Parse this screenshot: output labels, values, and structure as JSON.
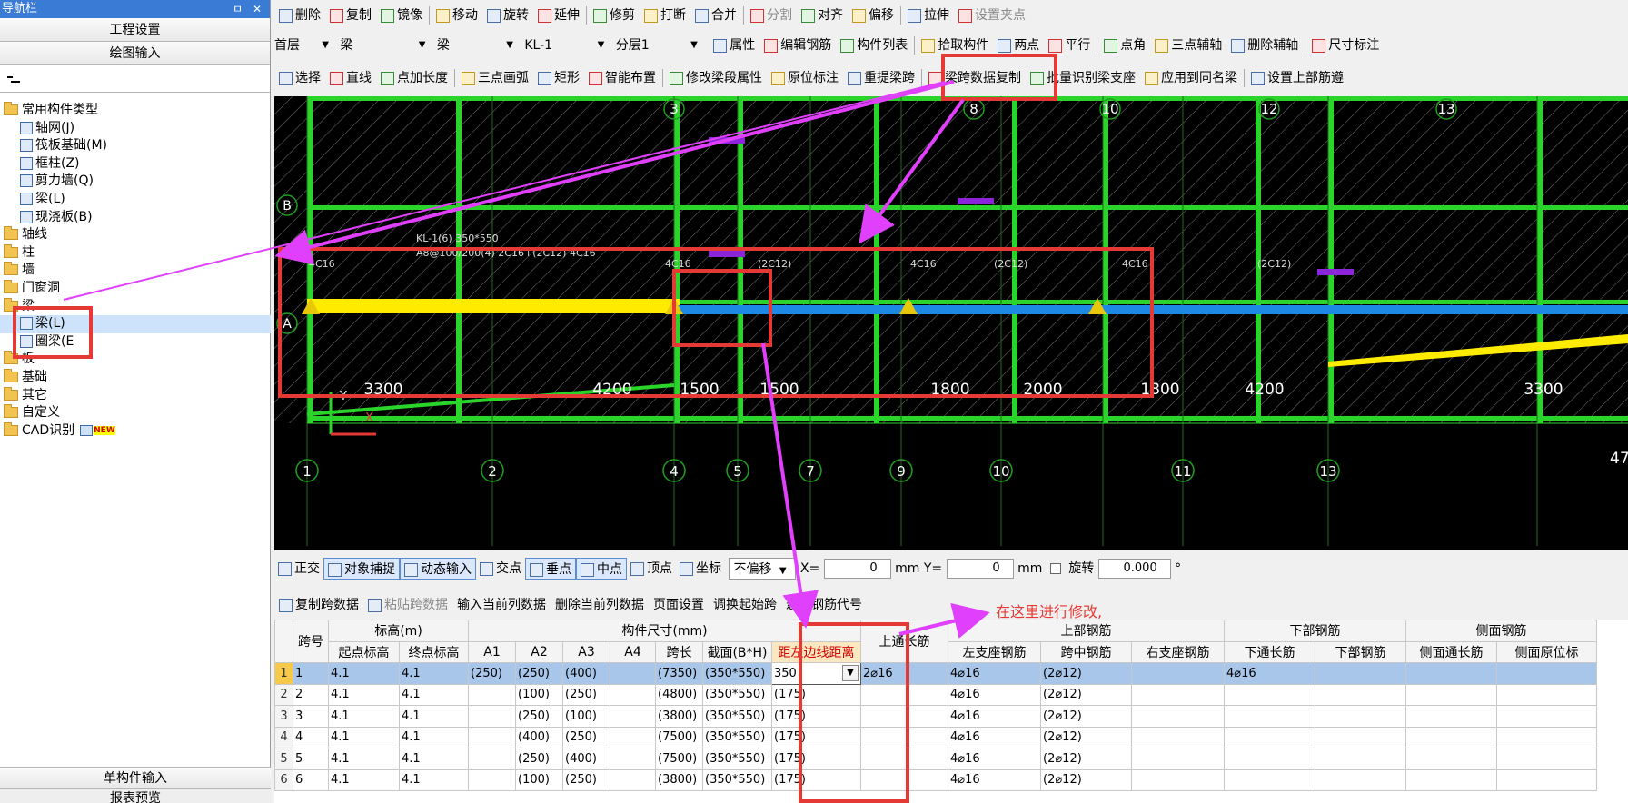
{
  "nav": {
    "title": "导航栏",
    "pin": "ㅁ",
    "close": "✕",
    "project_settings": "工程设置",
    "drawing_input": "绘图输入",
    "tree": [
      {
        "label": "常用构件类型",
        "kind": "folder",
        "level": 0
      },
      {
        "label": "轴网(J)",
        "kind": "leaf",
        "level": 1
      },
      {
        "label": "筏板基础(M)",
        "kind": "leaf",
        "level": 1
      },
      {
        "label": "框柱(Z)",
        "kind": "leaf",
        "level": 1
      },
      {
        "label": "剪力墙(Q)",
        "kind": "leaf",
        "level": 1
      },
      {
        "label": "梁(L)",
        "kind": "leaf",
        "level": 1
      },
      {
        "label": "现浇板(B)",
        "kind": "leaf",
        "level": 1
      },
      {
        "label": "轴线",
        "kind": "folder",
        "level": 0
      },
      {
        "label": "柱",
        "kind": "folder",
        "level": 0
      },
      {
        "label": "墙",
        "kind": "folder",
        "level": 0
      },
      {
        "label": "门窗洞",
        "kind": "folder",
        "level": 0
      },
      {
        "label": "梁",
        "kind": "folder",
        "level": 0
      },
      {
        "label": "梁(L)",
        "kind": "leaf",
        "level": 1
      },
      {
        "label": "圈梁(E",
        "kind": "leaf",
        "level": 1
      },
      {
        "label": "板",
        "kind": "folder",
        "level": 0
      },
      {
        "label": "基础",
        "kind": "folder",
        "level": 0
      },
      {
        "label": "其它",
        "kind": "folder",
        "level": 0
      },
      {
        "label": "自定义",
        "kind": "folder",
        "level": 0
      },
      {
        "label": "CAD识别",
        "kind": "folder",
        "level": 0,
        "badge": "NEW"
      }
    ],
    "single_input": "单构件输入",
    "report_preview": "报表预览"
  },
  "toolbar1": [
    "删除",
    "复制",
    "镜像",
    "移动",
    "旋转",
    "延伸",
    "修剪",
    "打断",
    "合并",
    "分割",
    "对齐",
    "偏移",
    "拉伸",
    "设置夹点"
  ],
  "toolbar1_disabled": [
    "分割",
    "设置夹点"
  ],
  "toolbar2": {
    "floor": "首层",
    "cat1": "梁",
    "cat2": "梁",
    "member": "KL-1",
    "layer": "分层1",
    "items": [
      "属性",
      "编辑钢筋",
      "构件列表",
      "拾取构件",
      "两点",
      "平行",
      "点角",
      "三点辅轴",
      "删除辅轴",
      "尺寸标注"
    ]
  },
  "toolbar3": [
    "选择",
    "直线",
    "点加长度",
    "三点画弧",
    "矩形",
    "智能布置",
    "修改梁段属性",
    "原位标注",
    "重提梁跨",
    "梁跨数据复制",
    "批量识别梁支座",
    "应用到同名梁",
    "设置上部筋遵"
  ],
  "canvas": {
    "axis_top": [
      "3",
      "8",
      "10",
      "12",
      "13"
    ],
    "axis_bottom": [
      "1",
      "2",
      "4",
      "5",
      "7",
      "9",
      "10",
      "11",
      "13"
    ],
    "row_labels": [
      "B",
      "A"
    ],
    "dims": [
      "3300",
      "4200",
      "1500",
      "1500",
      "1800",
      "2000",
      "1800",
      "4200",
      "3300"
    ],
    "edge_num": "47",
    "beam_notes": [
      "KL-1(6) 350*550",
      "A8@100/200(4) 2C16+(2C12) 4C16",
      "4C16",
      "4C16",
      "(2C12)",
      "4C16",
      "(2C12)",
      "4C16",
      "(2C12)"
    ],
    "axis_y": "Y",
    "axis_x": "X"
  },
  "snapbar": {
    "items": [
      "正交",
      "对象捕捉",
      "动态输入",
      "交点",
      "垂点",
      "中点",
      "顶点",
      "坐标"
    ],
    "offset": "不偏移",
    "x_label": "X=",
    "x_val": "0",
    "mm": "mm",
    "y_label": "Y=",
    "y_val": "0",
    "rotate": "旋转",
    "rotate_val": "0.000",
    "deg": "°"
  },
  "table_toolbar": [
    "复制跨数据",
    "粘贴跨数据",
    "输入当前列数据",
    "删除当前列数据",
    "页面设置",
    "调换起始跨",
    "悬臂钢筋代号"
  ],
  "table_toolbar_disabled": [
    "粘贴跨数据"
  ],
  "annotation": "在这里进行修改,",
  "table": {
    "group_headers": [
      "跨号",
      "标高(m)",
      "构件尺寸(mm)",
      "上通长筋",
      "上部钢筋",
      "下部钢筋",
      "侧面钢筋"
    ],
    "sub_headers": [
      "起点标高",
      "终点标高",
      "A1",
      "A2",
      "A3",
      "A4",
      "跨长",
      "截面(B*H)",
      "距左边线距离",
      "左支座钢筋",
      "跨中钢筋",
      "右支座钢筋",
      "下通长筋",
      "下部钢筋",
      "侧面通长筋",
      "侧面原位标"
    ],
    "rows": [
      {
        "idx": "1",
        "span": "1",
        "s": "4.1",
        "e": "4.1",
        "a1": "(250)",
        "a2": "(250)",
        "a3": "(400)",
        "a4": "",
        "len": "(7350)",
        "sec": "(350*550)",
        "dist": "350",
        "top": "2⌀16",
        "left": "4⌀16",
        "mid": "(2⌀12)",
        "right": "",
        "botlong": "4⌀16",
        "bot": "",
        "side": "",
        "sidein": ""
      },
      {
        "idx": "2",
        "span": "2",
        "s": "4.1",
        "e": "4.1",
        "a1": "",
        "a2": "(100)",
        "a3": "(250)",
        "a4": "",
        "len": "(4800)",
        "sec": "(350*550)",
        "dist": "(175)",
        "top": "",
        "left": "4⌀16",
        "mid": "(2⌀12)",
        "right": "",
        "botlong": "",
        "bot": "",
        "side": "",
        "sidein": ""
      },
      {
        "idx": "3",
        "span": "3",
        "s": "4.1",
        "e": "4.1",
        "a1": "",
        "a2": "(250)",
        "a3": "(100)",
        "a4": "",
        "len": "(3800)",
        "sec": "(350*550)",
        "dist": "(175)",
        "top": "",
        "left": "4⌀16",
        "mid": "(2⌀12)",
        "right": "",
        "botlong": "",
        "bot": "",
        "side": "",
        "sidein": ""
      },
      {
        "idx": "4",
        "span": "4",
        "s": "4.1",
        "e": "4.1",
        "a1": "",
        "a2": "(400)",
        "a3": "(250)",
        "a4": "",
        "len": "(7500)",
        "sec": "(350*550)",
        "dist": "(175)",
        "top": "",
        "left": "4⌀16",
        "mid": "(2⌀12)",
        "right": "",
        "botlong": "",
        "bot": "",
        "side": "",
        "sidein": ""
      },
      {
        "idx": "5",
        "span": "5",
        "s": "4.1",
        "e": "4.1",
        "a1": "",
        "a2": "(250)",
        "a3": "(400)",
        "a4": "",
        "len": "(7500)",
        "sec": "(350*550)",
        "dist": "(175)",
        "top": "",
        "left": "4⌀16",
        "mid": "(2⌀12)",
        "right": "",
        "botlong": "",
        "bot": "",
        "side": "",
        "sidein": ""
      },
      {
        "idx": "6",
        "span": "6",
        "s": "4.1",
        "e": "4.1",
        "a1": "",
        "a2": "(100)",
        "a3": "(250)",
        "a4": "",
        "len": "(3800)",
        "sec": "(350*550)",
        "dist": "(175)",
        "top": "",
        "left": "4⌀16",
        "mid": "(2⌀12)",
        "right": "",
        "botlong": "",
        "bot": "",
        "side": "",
        "sidein": ""
      }
    ]
  },
  "colors": {
    "accent": "#e53935",
    "arrow": "#e040fb",
    "beam_yellow": "#ffeb00",
    "beam_blue": "#1e88e5",
    "grid_green": "#33ff33"
  }
}
